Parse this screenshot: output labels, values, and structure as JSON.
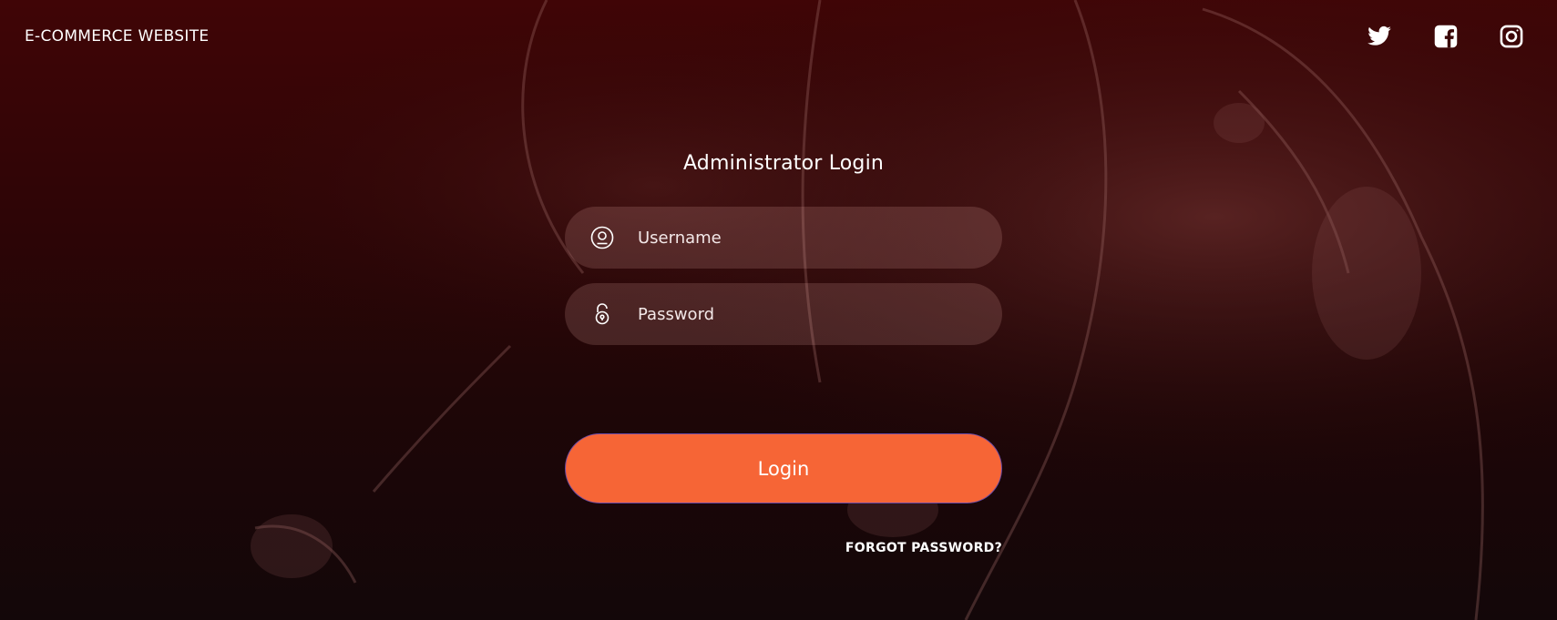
{
  "header": {
    "brand": "E-COMMERCE WEBSITE",
    "social_icons": [
      "twitter-icon",
      "facebook-icon",
      "instagram-icon"
    ]
  },
  "login": {
    "title": "Administrator Login",
    "username_placeholder": "Username",
    "username_value": "",
    "password_placeholder": "Password",
    "password_value": "",
    "login_label": "Login",
    "forgot_label": "FORGOT PASSWORD?"
  },
  "colors": {
    "accent": "#f66536",
    "background_top": "#400506",
    "background_bottom": "#130709",
    "text": "#ffffff"
  }
}
